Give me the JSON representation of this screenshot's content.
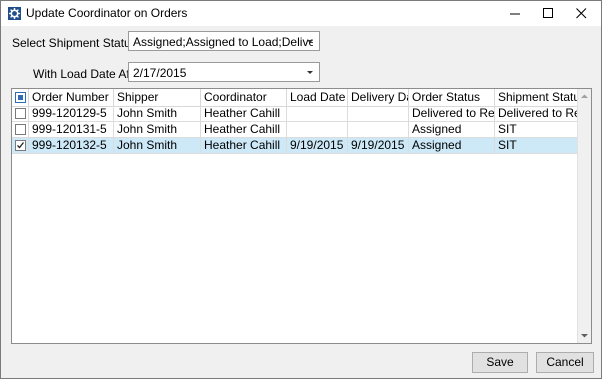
{
  "window": {
    "title": "Update Coordinator on Orders"
  },
  "filters": {
    "status_label": "Select Shipment Status(es):",
    "status_value": "Assigned;Assigned to Load;Delivered to...",
    "date_label": "With Load Date After:",
    "date_value": "2/17/2015"
  },
  "grid": {
    "columns": [
      "Order Number",
      "Shipper",
      "Coordinator",
      "Load Date",
      "Delivery Date",
      "Order Status",
      "Shipment Status"
    ],
    "rows": [
      {
        "checked": false,
        "selected": false,
        "cells": [
          "999-120129-5",
          "John Smith",
          "Heather Cahill",
          "",
          "",
          "Delivered to Resi...",
          "Delivered to Resi..."
        ]
      },
      {
        "checked": false,
        "selected": false,
        "cells": [
          "999-120131-5",
          "John Smith",
          "Heather Cahill",
          "",
          "",
          "Assigned",
          "SIT"
        ]
      },
      {
        "checked": true,
        "selected": true,
        "cells": [
          "999-120132-5",
          "John Smith",
          "Heather Cahill",
          "9/19/2015",
          "9/19/2015",
          "Assigned",
          "SIT"
        ]
      }
    ]
  },
  "buttons": {
    "save": "Save",
    "cancel": "Cancel"
  },
  "colors": {
    "selected_row": "#cde8f7",
    "accent": "#2e6db4"
  }
}
